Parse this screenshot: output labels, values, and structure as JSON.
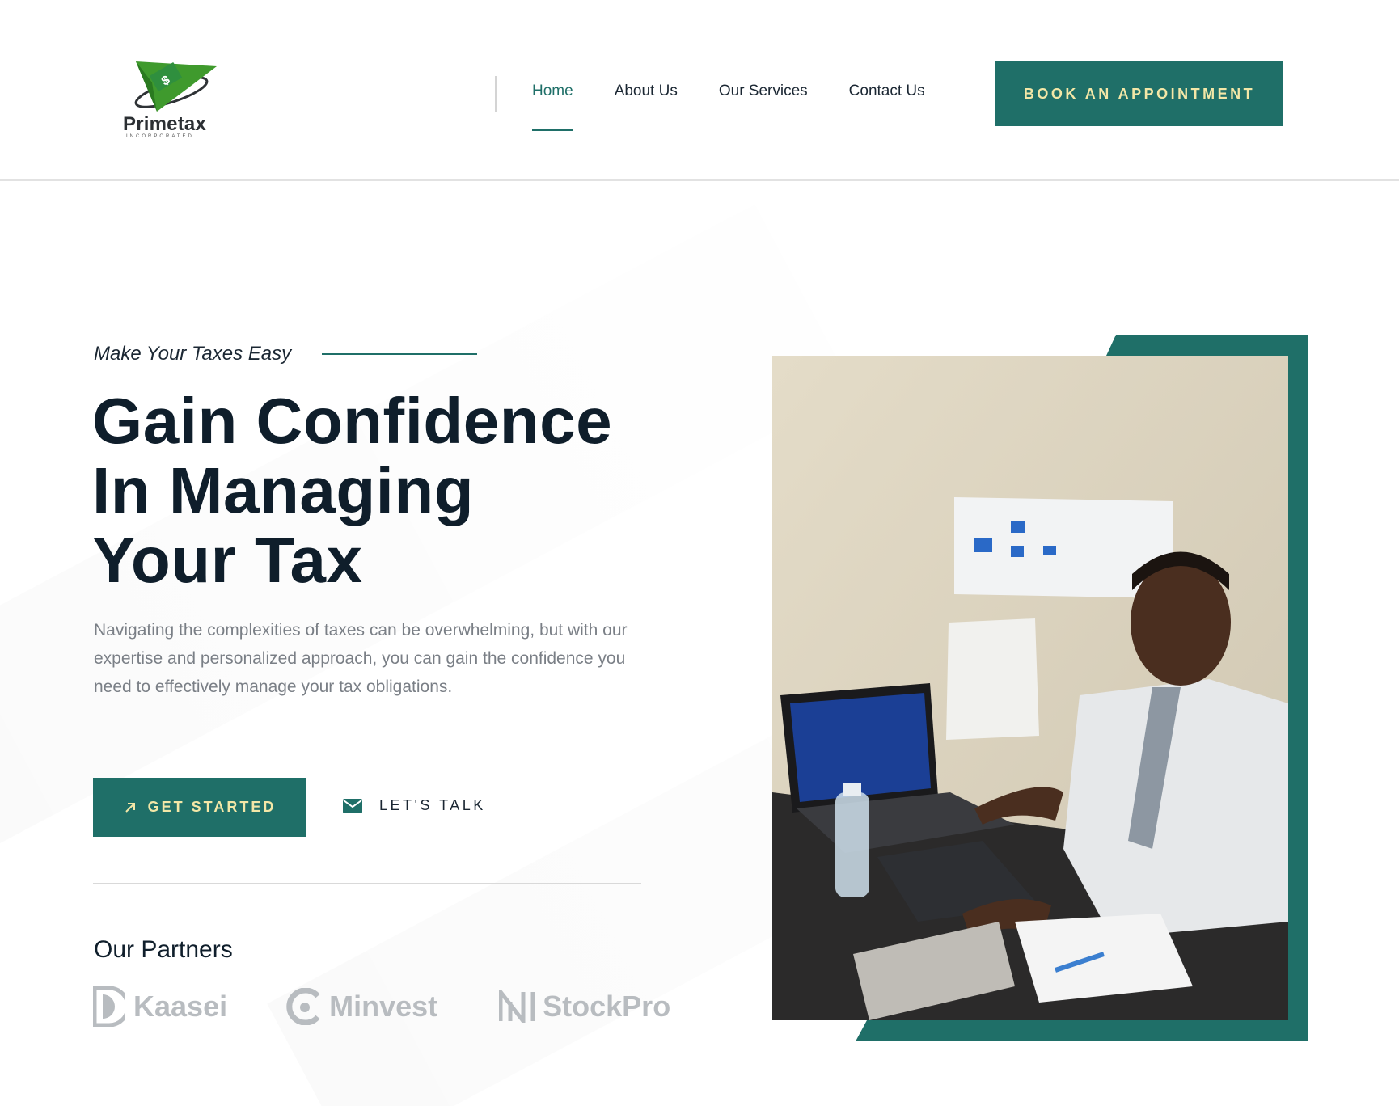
{
  "brand": {
    "name": "Primetax",
    "tagline": "INCORPORATED"
  },
  "nav": {
    "items": [
      {
        "label": "Home",
        "active": true
      },
      {
        "label": "About Us",
        "active": false
      },
      {
        "label": "Our Services",
        "active": false
      },
      {
        "label": "Contact Us",
        "active": false
      }
    ],
    "cta": "BOOK AN APPOINTMENT"
  },
  "hero": {
    "eyebrow": "Make Your Taxes Easy",
    "headline_lines": [
      "Gain Confidence",
      "In Managing",
      "Your Tax"
    ],
    "description": "Navigating the complexities of taxes can be overwhelming, but with our expertise and personalized approach, you can gain the confidence you need to effectively manage your tax obligations.",
    "primary_button": "GET STARTED",
    "secondary_button": "LET'S TALK"
  },
  "partners": {
    "title": "Our Partners",
    "logos": [
      "Kaasei",
      "Minvest",
      "StockPro"
    ]
  },
  "colors": {
    "accent": "#1f6f68",
    "button_text": "#f3e7a7",
    "heading": "#0f1e2b",
    "muted": "#7a7f86",
    "partner_grey": "#b8bcc0"
  },
  "icons": {
    "primary_button": "arrow-up-right-icon",
    "secondary_button": "envelope-icon"
  }
}
